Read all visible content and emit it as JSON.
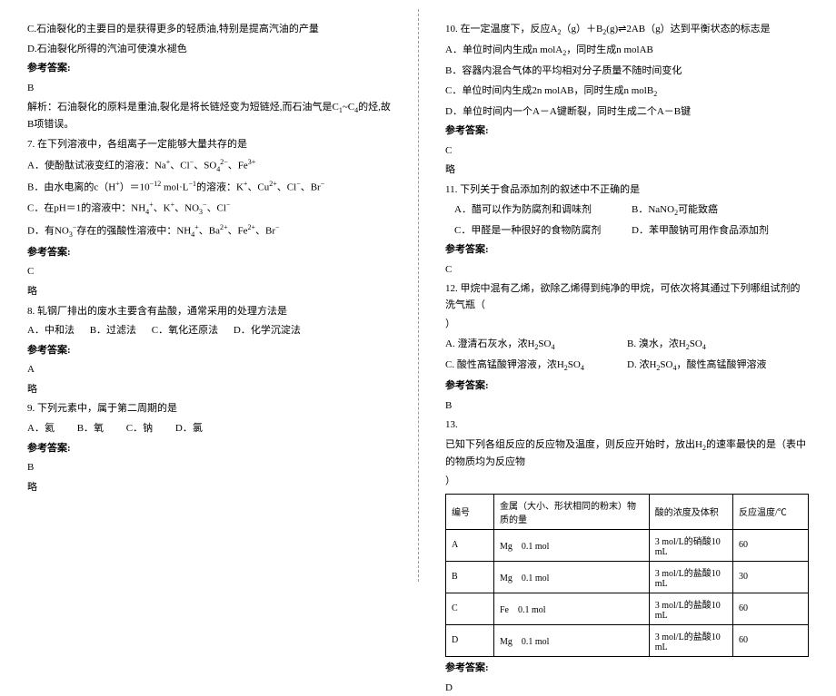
{
  "left": {
    "l1": "C.石油裂化的主要目的是获得更多的轻质油,特别是提高汽油的产量",
    "l2": "D.石油裂化所得的汽油可使溴水褪色",
    "ak_label": "参考答案:",
    "l3": "B",
    "l4_pre": "解析：石油裂化的原料是重油,裂化是将长链烃变为短链烃,而石油气是C",
    "l4_s1": "1",
    "l4_mid": "~C",
    "l4_s2": "4",
    "l4_post": "的烃,故B项错误。",
    "q7": "7. 在下列溶液中，各组离子一定能够大量共存的是",
    "q7a_pre": "A．使酚酞试液变红的溶液：Na",
    "q7a_1": "+",
    "q7a_2": "、Cl",
    "q7a_3": "−",
    "q7a_4": "、SO",
    "q7a_5": "4",
    "q7a_6": "2−",
    "q7a_7": "、Fe",
    "q7a_8": "3+",
    "q7b_pre": "B．由水电离的c（H",
    "q7b_1": "+",
    "q7b_2": "）＝10",
    "q7b_3": "−12",
    "q7b_4": " mol·L",
    "q7b_5": "−1",
    "q7b_6": "的溶液：K",
    "q7b_7": "+",
    "q7b_8": "、Cu",
    "q7b_9": "2+",
    "q7b_10": "、Cl",
    "q7b_11": "−",
    "q7b_12": "、Br",
    "q7b_13": "−",
    "q7c_pre": "C．在pH＝1的溶液中：NH",
    "q7c_1": "4",
    "q7c_2": "+",
    "q7c_3": "、K",
    "q7c_4": "+",
    "q7c_5": "、NO",
    "q7c_6": "3",
    "q7c_7": "−",
    "q7c_8": "、Cl",
    "q7c_9": "−",
    "q7d_pre": "D．有NO",
    "q7d_1": "3",
    "q7d_2": "−",
    "q7d_3": "存在的强酸性溶液中：NH",
    "q7d_4": "4",
    "q7d_5": "+",
    "q7d_6": "、Ba",
    "q7d_7": "2+",
    "q7d_8": "、Fe",
    "q7d_9": "2+",
    "q7d_10": "、Br",
    "q7d_11": "−",
    "a7": "C",
    "a7n": "略",
    "q8": "8. 轧钢厂排出的废水主要含有盐酸，通常采用的处理方法是",
    "q8a": "A．中和法",
    "q8b": "B．过滤法",
    "q8c": "C．氧化还原法",
    "q8d": "D．化学沉淀法",
    "a8": "A",
    "a8n": "略",
    "q9": "9. 下列元素中，属于第二周期的是",
    "q9a": "A．氦",
    "q9b": "B．氧",
    "q9c": "C．钠",
    "q9d": "D．氯",
    "a9": "B",
    "a9n": "略"
  },
  "right": {
    "q10_pre": "10. 在一定温度下，反应A",
    "q10_1": "2",
    "q10_2": "（g）＋B",
    "q10_3": "2",
    "q10_4": "(g)⇌2AB（g）达到平衡状态的标志是",
    "q10a_pre": "A．单位时间内生成n molA",
    "q10a_1": "2",
    "q10a_2": "，同时生成n molAB",
    "q10b": "B．容器内混合气体的平均相对分子质量不随时间变化",
    "q10c_pre": "C．单位时间内生成2n molAB，同时生成n molB",
    "q10c_1": "2",
    "q10d": "D．单位时间内一个A－A键断裂，同时生成二个A－B键",
    "ak_label": "参考答案:",
    "a10": "C",
    "a10n": "略",
    "q11": "11. 下列关于食品添加剂的叙述中不正确的是",
    "q11a": "A．醋可以作为防腐剂和调味剂",
    "q11b_pre": "B．NaNO",
    "q11b_1": "2",
    "q11b_2": "可能致癌",
    "q11c": "C．甲醛是一种很好的食物防腐剂",
    "q11d": "D．苯甲酸钠可用作食品添加剂",
    "a11": "C",
    "q12": "12. 甲烷中混有乙烯，欲除乙烯得到纯净的甲烷，可依次将其通过下列哪组试剂的洗气瓶（",
    "q12_end": "）",
    "q12a_pre": "A. 澄清石灰水，浓H",
    "q12a_1": "2",
    "q12a_2": "SO",
    "q12a_3": "4",
    "q12b_pre": "B. 溴水，浓H",
    "q12b_1": "2",
    "q12b_2": "SO",
    "q12b_3": "4",
    "q12c_pre": "C. 酸性高锰酸钾溶液，浓H",
    "q12c_1": "2",
    "q12c_2": "SO",
    "q12c_3": "4",
    "q12d_pre": "D. 浓H",
    "q12d_1": "2",
    "q12d_2": "SO",
    "q12d_3": "4",
    "q12d_4": "，酸性高锰酸钾溶液",
    "a12": "B",
    "q13num": "13.",
    "q13_pre": "已知下列各组反应的反应物及温度，则反应开始时，放出H",
    "q13_1": "2",
    "q13_2": "的速率最快的是（表中的物质均为反应物",
    "q13_end": "）",
    "table": {
      "h1": "编号",
      "h2": "金属（大小、形状相同的粉末）物质的量",
      "h3": "酸的浓度及体积",
      "h4": "反应温度/℃",
      "rows": [
        {
          "c1": "A",
          "c2": "Mg　0.1 mol",
          "c3": "3 mol/L的硝酸10 mL",
          "c4": "60"
        },
        {
          "c1": "B",
          "c2": "Mg　0.1 mol",
          "c3": "3 mol/L的盐酸10 mL",
          "c4": "30"
        },
        {
          "c1": "C",
          "c2": "Fe　0.1 mol",
          "c3": "3 mol/L的盐酸10 mL",
          "c4": "60"
        },
        {
          "c1": "D",
          "c2": "Mg　0.1 mol",
          "c3": "3 mol/L的盐酸10 mL",
          "c4": "60"
        }
      ]
    },
    "a13": "D"
  }
}
